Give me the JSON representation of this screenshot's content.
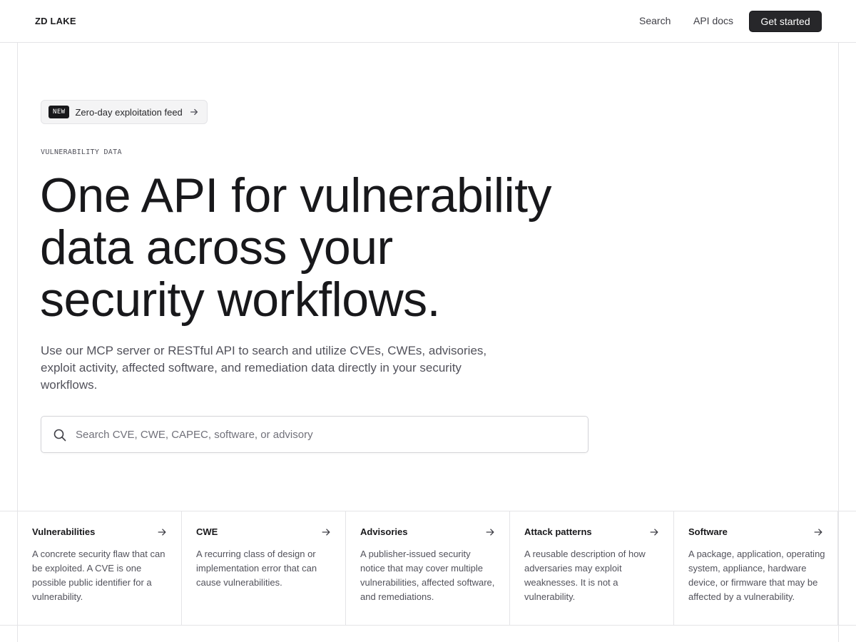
{
  "header": {
    "brand": "ZD LAKE",
    "nav": {
      "search": "Search",
      "api_docs": "API docs"
    },
    "cta": "Get started"
  },
  "announcement": {
    "badge": "NEW",
    "text": "Zero-day exploitation feed",
    "icon": "arrow-right-icon"
  },
  "hero": {
    "eyebrow": "VULNERABILITY DATA",
    "headline": [
      "One API for vulnerability",
      "data across your",
      "security workflows."
    ],
    "lede": "Use our MCP server or RESTful API to search and utilize CVEs, CWEs, advisories, exploit activity, affected software, and remediation data directly in your security workflows."
  },
  "search": {
    "placeholder": "Search CVE, CWE, CAPEC, software, or advisory",
    "value": "",
    "icon": "search-icon"
  },
  "categories": [
    {
      "title": "Vulnerabilities",
      "description": "A concrete security flaw that can be exploited. A CVE is one possible public identifier for a vulnerability."
    },
    {
      "title": "CWE",
      "description": "A recurring class of design or implementation error that can cause vulnerabilities."
    },
    {
      "title": "Advisories",
      "description": "A publisher-issued security notice that may cover multiple vulnerabilities, affected software, and remediations."
    },
    {
      "title": "Attack patterns",
      "description": "A reusable description of how adversaries may exploit weaknesses. It is not a vulnerability."
    },
    {
      "title": "Software",
      "description": "A package, application, operating system, appliance, hardware device, or firmware that may be affected by a vulnerability."
    }
  ],
  "colors": {
    "text": "#18181b",
    "muted": "#52525b",
    "border": "#e4e4e7",
    "cta_bg": "#27272a",
    "pill_bg": "#f4f4f5"
  }
}
